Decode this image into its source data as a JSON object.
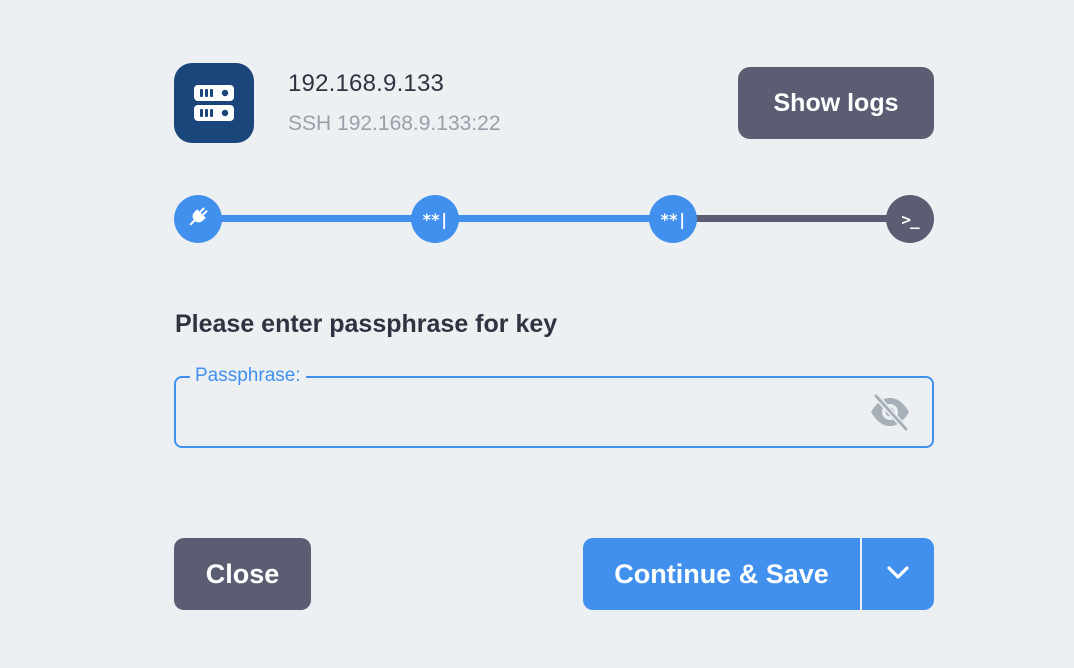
{
  "host": {
    "title": "192.168.9.133",
    "subtitle": "SSH 192.168.9.133:22",
    "icon": "server-icon",
    "icon_bg": "#1b467c"
  },
  "header": {
    "show_logs_label": "Show logs"
  },
  "progress": {
    "steps": [
      {
        "icon": "plug-icon",
        "text": "",
        "state": "done"
      },
      {
        "icon": "password-cursor-icon",
        "text": "**|",
        "state": "done"
      },
      {
        "icon": "password-cursor-icon",
        "text": "**|",
        "state": "done"
      },
      {
        "icon": "terminal-icon",
        "text": ">_",
        "state": "pending"
      }
    ]
  },
  "form": {
    "prompt": "Please enter passphrase for key",
    "passphrase_label": "Passphrase:",
    "passphrase_value": "",
    "visibility_icon": "eye-off-icon"
  },
  "footer": {
    "close_label": "Close",
    "continue_label": "Continue & Save",
    "dropdown_icon": "chevron-down-icon"
  },
  "colors": {
    "background": "#edf0f2",
    "accent": "#4190ee",
    "dark_button": "#5b5d73",
    "text": "#2f3240",
    "muted": "#9a9eab"
  }
}
